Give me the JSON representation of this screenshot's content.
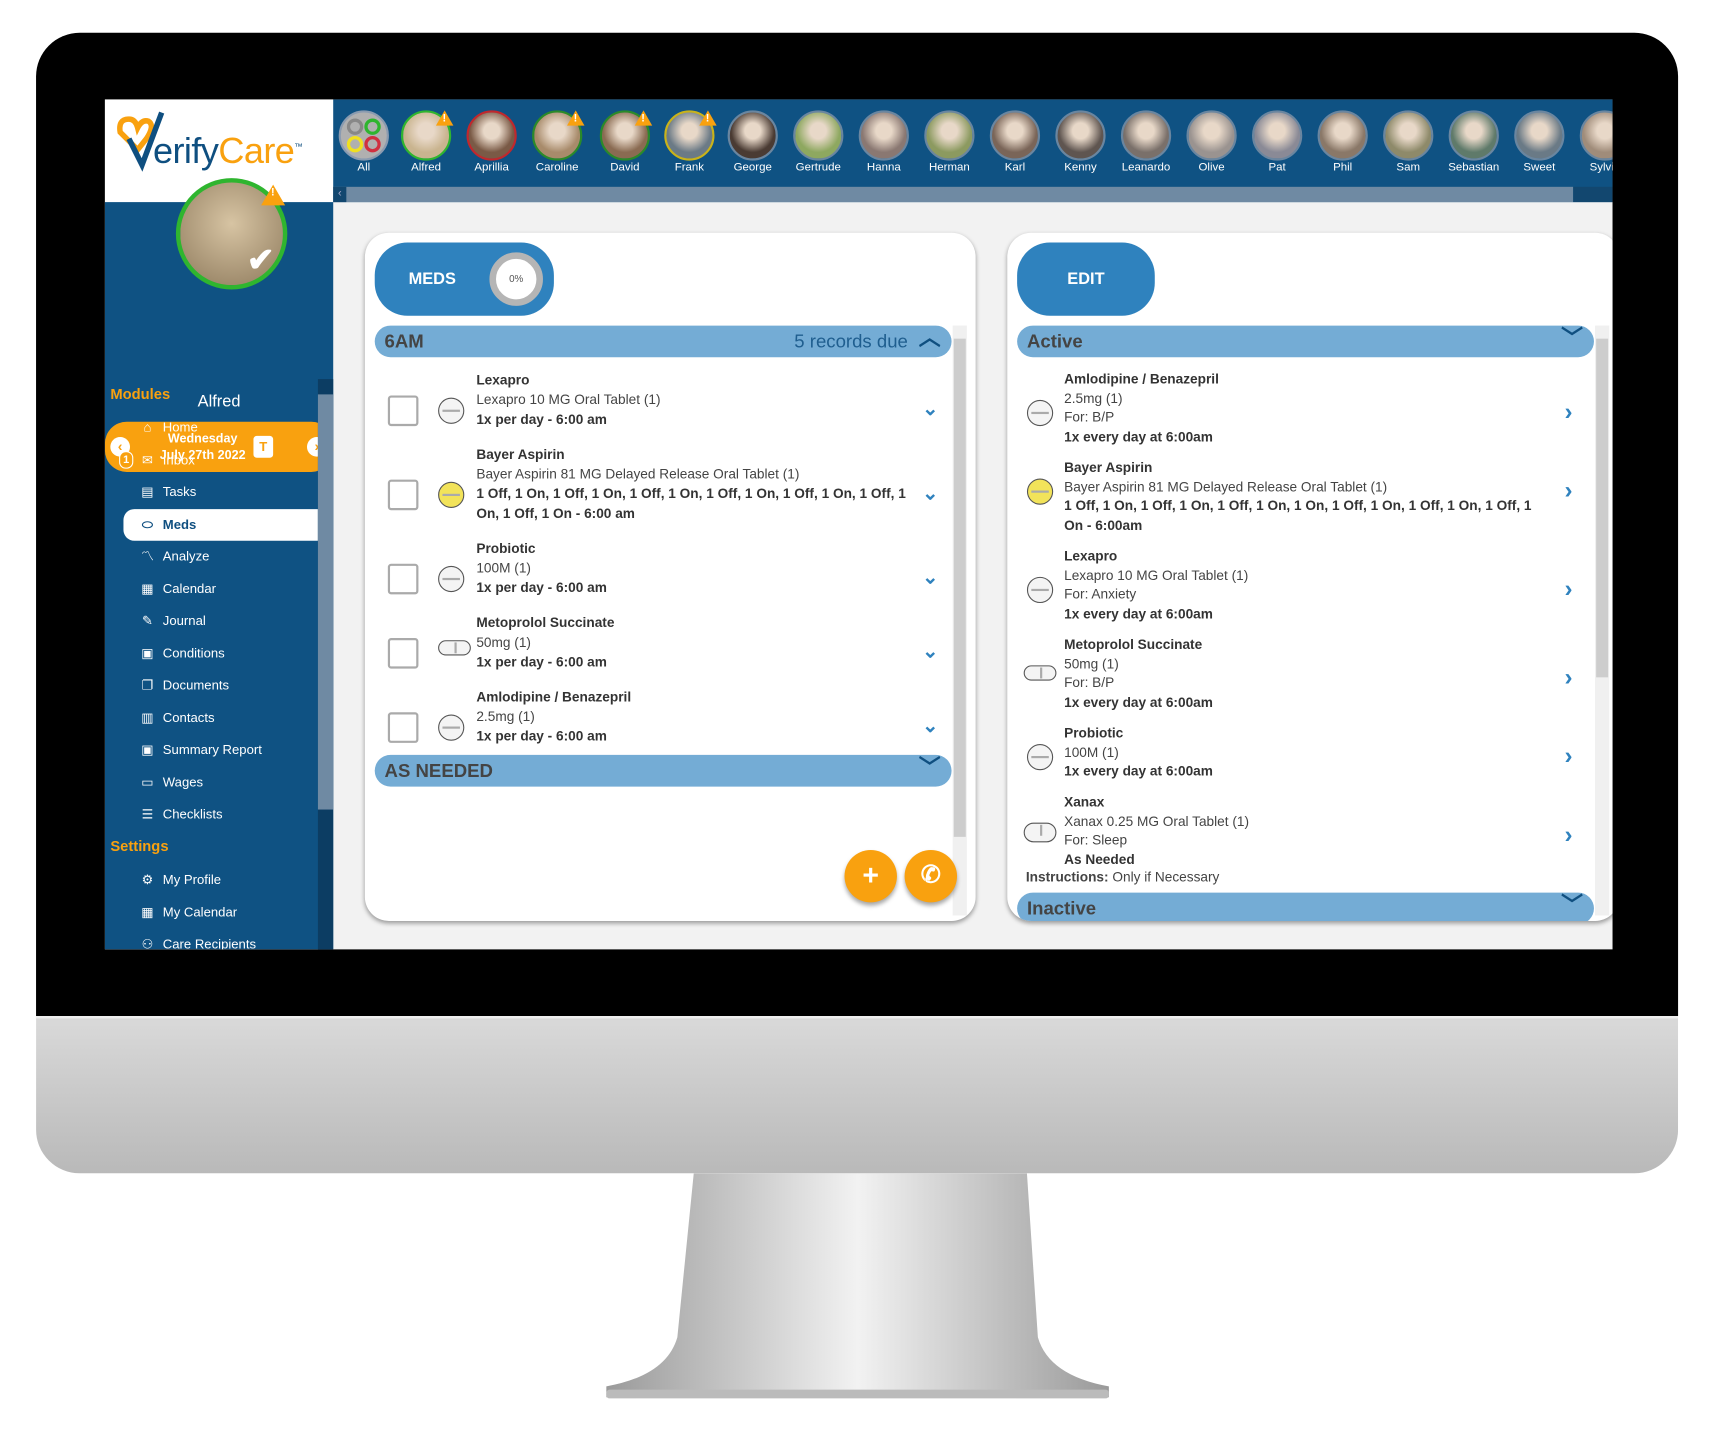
{
  "app": {
    "logo_text_a": "V",
    "logo_text_b": "erify",
    "logo_text_c": "Care",
    "trademark": "™"
  },
  "profile": {
    "name": "Alfred",
    "date_line1": "Wednesday",
    "date_line2": "July 27th 2022",
    "today_label": "T"
  },
  "recipients": [
    {
      "name": "All",
      "ring": "#8a9bb0",
      "warn": false,
      "check": false,
      "tone": "#aaa"
    },
    {
      "name": "Alfred",
      "ring": "#2fb52f",
      "warn": true,
      "check": true,
      "tone": "#c9b48f"
    },
    {
      "name": "Aprillia",
      "ring": "#c0282d",
      "warn": false,
      "check": true,
      "tone": "#7a5a46"
    },
    {
      "name": "Caroline",
      "ring": "#2a8a2a",
      "warn": true,
      "check": true,
      "tone": "#a88b6b"
    },
    {
      "name": "David",
      "ring": "#2a8a2a",
      "warn": true,
      "check": true,
      "tone": "#8a6b52"
    },
    {
      "name": "Frank",
      "ring": "#c9b31a",
      "warn": true,
      "check": true,
      "tone": "#6b7a86"
    },
    {
      "name": "George",
      "ring": "#6a86a0",
      "tone": "#4a3b33"
    },
    {
      "name": "Gertrude",
      "ring": "#6a86a0",
      "tone": "#8ea860"
    },
    {
      "name": "Hanna",
      "ring": "#6a86a0",
      "tone": "#8a7872"
    },
    {
      "name": "Herman",
      "ring": "#6a86a0",
      "tone": "#8c9a60"
    },
    {
      "name": "Karl",
      "ring": "#6a86a0",
      "tone": "#7a6558"
    },
    {
      "name": "Kenny",
      "ring": "#6a86a0",
      "tone": "#5f5550"
    },
    {
      "name": "Leanardo",
      "ring": "#6a86a0",
      "tone": "#7a706a"
    },
    {
      "name": "Olive",
      "ring": "#6a86a0",
      "tone": "#9a9390"
    },
    {
      "name": "Pat",
      "ring": "#6a86a0",
      "tone": "#8a8a96"
    },
    {
      "name": "Phil",
      "ring": "#6a86a0",
      "tone": "#8a7868"
    },
    {
      "name": "Sam",
      "ring": "#6a86a0",
      "tone": "#8e8a6a"
    },
    {
      "name": "Sebastian",
      "ring": "#6a86a0",
      "tone": "#5f7a6a"
    },
    {
      "name": "Sweet",
      "ring": "#6a86a0",
      "tone": "#6a7a86"
    },
    {
      "name": "Sylvia",
      "ring": "#6a86a0",
      "tone": "#a08c7a"
    }
  ],
  "sidebar": {
    "modules_heading": "Modules",
    "modules": [
      {
        "label": "Home",
        "icon": "home-icon",
        "glyph": "⌂"
      },
      {
        "label": "Inbox",
        "icon": "envelope-icon",
        "glyph": "✉",
        "badge": "1"
      },
      {
        "label": "Tasks",
        "icon": "clipboard-icon",
        "glyph": "▤"
      },
      {
        "label": "Meds",
        "icon": "pill-icon",
        "glyph": "⬭",
        "selected": true
      },
      {
        "label": "Analyze",
        "icon": "chart-line-icon",
        "glyph": "〽"
      },
      {
        "label": "Calendar",
        "icon": "calendar-icon",
        "glyph": "▦"
      },
      {
        "label": "Journal",
        "icon": "edit-icon",
        "glyph": "✎"
      },
      {
        "label": "Conditions",
        "icon": "medical-file-icon",
        "glyph": "▣"
      },
      {
        "label": "Documents",
        "icon": "documents-icon",
        "glyph": "❐"
      },
      {
        "label": "Contacts",
        "icon": "contact-card-icon",
        "glyph": "▥"
      },
      {
        "label": "Summary Report",
        "icon": "report-icon",
        "glyph": "▣"
      },
      {
        "label": "Wages",
        "icon": "money-icon",
        "glyph": "▭"
      },
      {
        "label": "Checklists",
        "icon": "list-icon",
        "glyph": "☰"
      }
    ],
    "settings_heading": "Settings",
    "settings": [
      {
        "label": "My Profile",
        "icon": "gear-icon",
        "glyph": "⚙"
      },
      {
        "label": "My Calendar",
        "icon": "calendar-icon",
        "glyph": "▦"
      },
      {
        "label": "Care Recipients",
        "icon": "users-icon",
        "glyph": "⚇"
      }
    ]
  },
  "schedule": {
    "tab_label": "MEDS",
    "progress_label": "0%",
    "progress": 0,
    "section_title": "6AM",
    "records_due": "5 records due",
    "items": [
      {
        "name": "Lexapro",
        "desc": "Lexapro 10 MG Oral Tablet (1)",
        "schedule": "1x per day - 6:00 am",
        "pill": "round"
      },
      {
        "name": "Bayer Aspirin",
        "desc": "Bayer Aspirin 81 MG Delayed Release Oral Tablet (1)",
        "schedule": "1 Off, 1 On, 1 Off, 1 On, 1 Off, 1 On, 1 Off, 1 On, 1 Off, 1 On, 1 Off, 1 On, 1 Off, 1 On - 6:00 am",
        "pill": "yellow"
      },
      {
        "name": "Probiotic",
        "desc": "100M (1)",
        "schedule": "1x per day - 6:00 am",
        "pill": "round"
      },
      {
        "name": "Metoprolol Succinate",
        "desc": "50mg (1)",
        "schedule": "1x per day - 6:00 am",
        "pill": "capsule"
      },
      {
        "name": "Amlodipine / Benazepril",
        "desc": "2.5mg (1)",
        "schedule": "1x per day - 6:00 am",
        "pill": "round"
      }
    ],
    "as_needed_title": "AS NEEDED"
  },
  "medlist": {
    "edit_label": "EDIT",
    "active_title": "Active",
    "inactive_title": "Inactive",
    "items": [
      {
        "name": "Amlodipine / Benazepril",
        "lines": [
          "2.5mg (1)",
          "For: B/P"
        ],
        "schedule": "1x every day at 6:00am",
        "pill": "round"
      },
      {
        "name": "Bayer Aspirin",
        "lines": [
          "Bayer Aspirin 81 MG Delayed Release Oral Tablet (1)"
        ],
        "schedule": "1 Off, 1 On, 1 Off, 1 On, 1 Off, 1 On, 1 On, 1 Off, 1 On, 1 Off, 1 On, 1 Off, 1 On - 6:00am",
        "pill": "yellow"
      },
      {
        "name": "Lexapro",
        "lines": [
          "Lexapro 10 MG Oral Tablet (1)",
          "For: Anxiety"
        ],
        "schedule": "1x every day at 6:00am",
        "pill": "round"
      },
      {
        "name": "Metoprolol Succinate",
        "lines": [
          "50mg (1)",
          "For: B/P"
        ],
        "schedule": "1x every day at 6:00am",
        "pill": "capsule"
      },
      {
        "name": "Probiotic",
        "lines": [
          "100M (1)"
        ],
        "schedule": "1x every day at 6:00am",
        "pill": "round"
      },
      {
        "name": "Xanax",
        "lines": [
          "Xanax 0.25 MG Oral Tablet (1)",
          "For: Sleep"
        ],
        "schedule": "As Needed",
        "pill": "oval"
      }
    ],
    "instructions_label": "Instructions:",
    "instructions_value": "Only if Necessary"
  },
  "colors": {
    "primary": "#0f5283",
    "accent": "#f9a10f",
    "section": "#74acd5",
    "button": "#2f82be"
  }
}
